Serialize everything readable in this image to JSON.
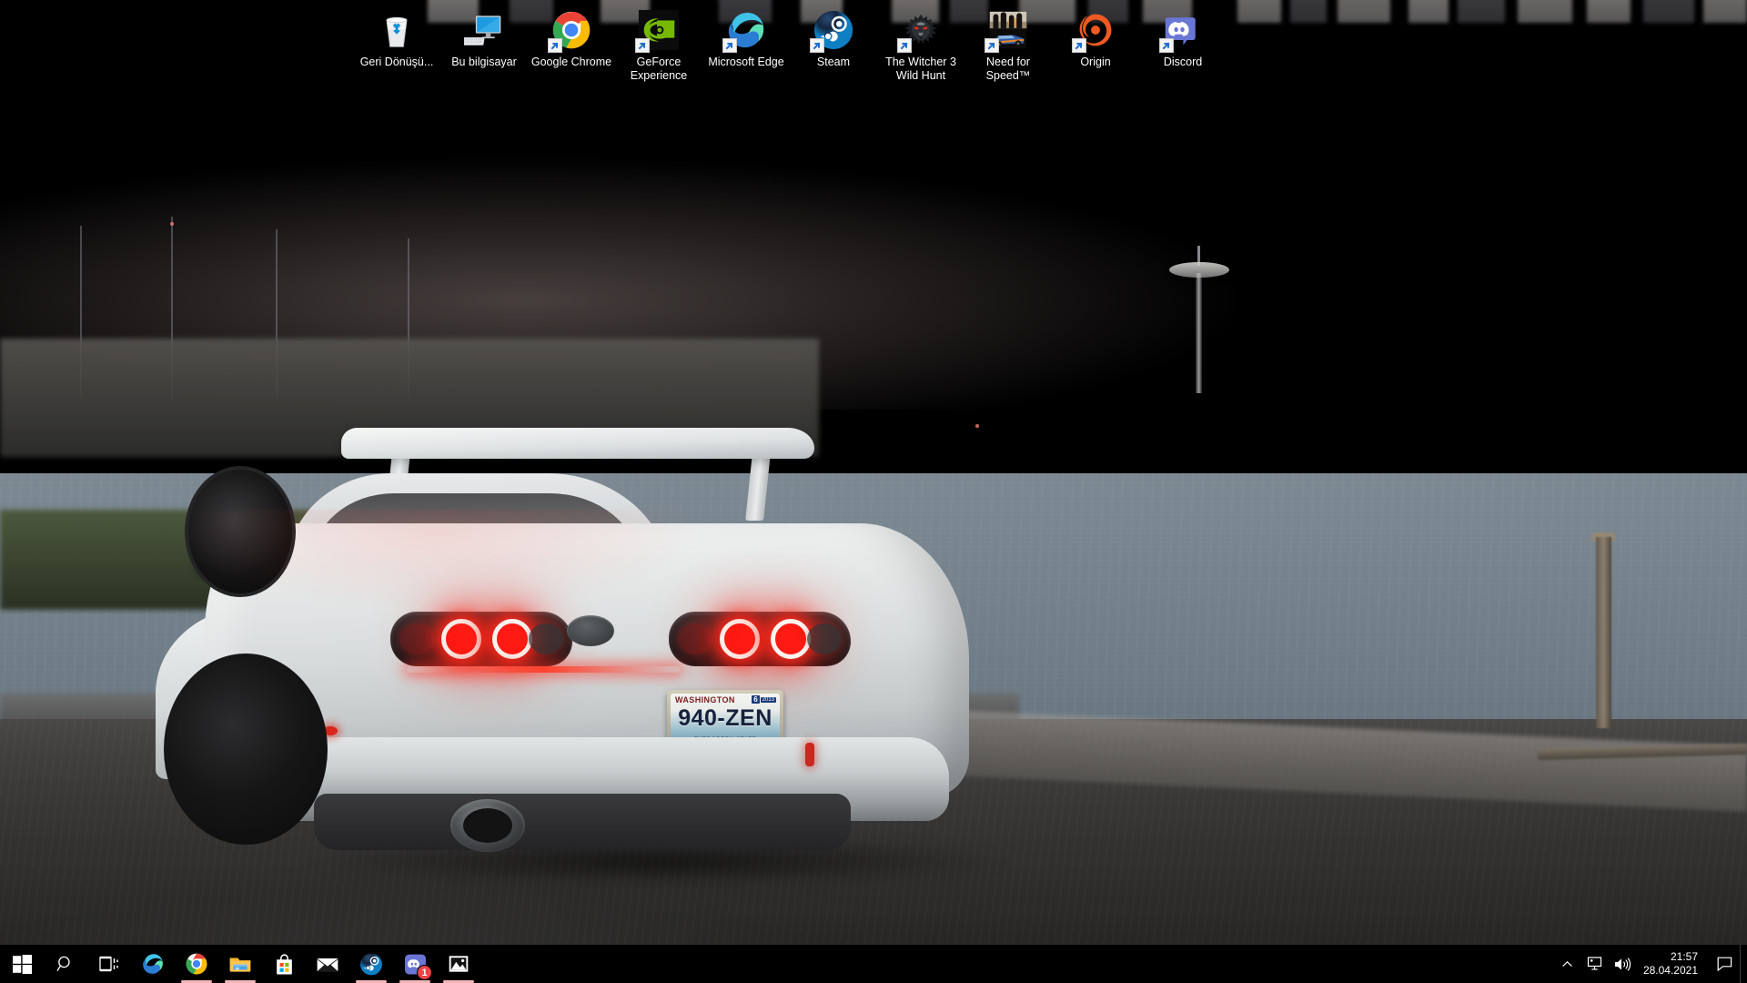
{
  "desktop": {
    "wallpaper_description": "White Toyota Supra MK4 at dusk by Seattle waterfront with Space Needle skyline",
    "wallpaper_colors": {
      "sky_top": "#b4a6a6",
      "sky_bottom": "#788893",
      "water": "#74818b",
      "road": "#35342f",
      "car_body": "#e6e8e8",
      "taillight_red": "#ff1a13"
    },
    "car": {
      "plate_state": "WASHINGTON",
      "plate_number": "940-ZEN",
      "plate_subtitle": "EVERGREEN STATE",
      "plate_month": "6",
      "plate_year": "2013"
    },
    "icons": [
      {
        "label": "Geri Dönüşü...",
        "name": "recycle-bin",
        "shortcut": false
      },
      {
        "label": "Bu bilgisayar",
        "name": "this-pc",
        "shortcut": false
      },
      {
        "label": "Google Chrome",
        "name": "google-chrome",
        "shortcut": true
      },
      {
        "label": "GeForce Experience",
        "name": "geforce-experience",
        "shortcut": true
      },
      {
        "label": "Microsoft Edge",
        "name": "microsoft-edge",
        "shortcut": true
      },
      {
        "label": "Steam",
        "name": "steam",
        "shortcut": true
      },
      {
        "label": "The Witcher 3 Wild Hunt",
        "name": "witcher-3",
        "shortcut": true
      },
      {
        "label": "Need for Speed™",
        "name": "need-for-speed",
        "shortcut": true
      },
      {
        "label": "Origin",
        "name": "origin",
        "shortcut": true
      },
      {
        "label": "Discord",
        "name": "discord",
        "shortcut": true
      }
    ]
  },
  "taskbar": {
    "background": "#000000",
    "active_indicator_color": "#f3b5b5",
    "start_label": "Start",
    "search_label": "Search",
    "taskview_label": "Task View",
    "apps": [
      {
        "name": "microsoft-edge",
        "label": "Microsoft Edge",
        "active": false,
        "badge": ""
      },
      {
        "name": "google-chrome",
        "label": "Google Chrome",
        "active": true,
        "badge": ""
      },
      {
        "name": "file-explorer",
        "label": "File Explorer",
        "active": true,
        "badge": ""
      },
      {
        "name": "microsoft-store",
        "label": "Microsoft Store",
        "active": false,
        "badge": ""
      },
      {
        "name": "mail",
        "label": "Mail",
        "active": false,
        "badge": ""
      },
      {
        "name": "steam",
        "label": "Steam",
        "active": true,
        "badge": ""
      },
      {
        "name": "discord",
        "label": "Discord",
        "active": true,
        "badge": "1"
      },
      {
        "name": "photos",
        "label": "Photos",
        "active": true,
        "badge": ""
      }
    ],
    "tray": {
      "show_hidden_label": "Show hidden icons",
      "network_label": "Network",
      "volume_label": "Volume",
      "time": "21:57",
      "date": "28.04.2021",
      "action_center_label": "Action Center"
    }
  }
}
